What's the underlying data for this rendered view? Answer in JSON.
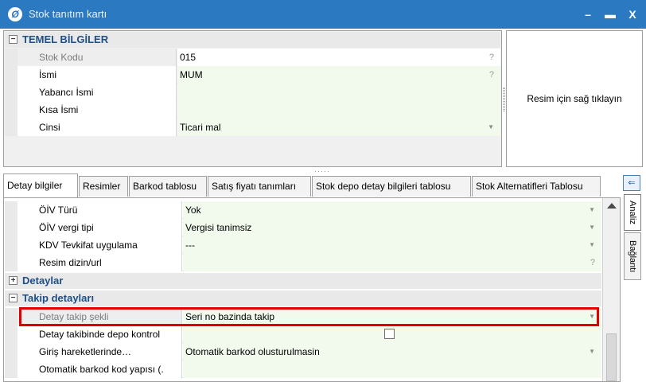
{
  "window": {
    "title": "Stok tanıtım kartı",
    "app_icon": "logo-icon",
    "minimize": "–",
    "maximize": "▬",
    "close": "X"
  },
  "top": {
    "category": "TEMEL BİLGİLER",
    "collapse_symbol": "−",
    "rows": [
      {
        "name": "Stok Kodu",
        "value": "015",
        "hint": "?"
      },
      {
        "name": "İsmi",
        "value": "MUM",
        "hint": "?"
      },
      {
        "name": "Yabancı İsmi",
        "value": ""
      },
      {
        "name": "Kısa İsmi",
        "value": ""
      },
      {
        "name": "Cinsi",
        "value": "Ticari mal",
        "arrow": "▼"
      }
    ]
  },
  "image_panel": {
    "text": "Resim için sağ tıklayın"
  },
  "splitter": "·····",
  "tabs": [
    "Detay bilgiler",
    "Resimler",
    "Barkod tablosu",
    "Satış fiyatı tanımları",
    "Stok depo detay bilgileri tablosu",
    "Stok Alternatifleri Tablosu"
  ],
  "bottom": {
    "rows_a": [
      {
        "name": "ÖİV Türü",
        "value": "Yok",
        "arrow": "▼"
      },
      {
        "name": "ÖİV vergi tipi",
        "value": "Vergisi tanimsiz",
        "arrow": "▼"
      },
      {
        "name": "KDV Tevkifat uygulama",
        "value": "---",
        "arrow": "▼"
      },
      {
        "name": "Resim dizin/url",
        "value": "",
        "hint": "?"
      }
    ],
    "cat_detaylar": "Detaylar",
    "cat_detaylar_symbol": "+",
    "cat_takip": "Takip detayları",
    "cat_takip_symbol": "−",
    "rows_b": [
      {
        "name": "Detay takip şekli",
        "value": "Seri no bazinda takip",
        "arrow": "▼"
      },
      {
        "name": "Detay takibinde depo kontrol",
        "value": "",
        "checked": false
      },
      {
        "name": "Giriş hareketlerinde…",
        "value": "Otomatik barkod olusturulmasin",
        "arrow": "▼"
      },
      {
        "name": "Otomatik barkod kod yapısı (.",
        "value": ""
      }
    ]
  },
  "side": {
    "pin": "⇐",
    "tabs": [
      "Analiz",
      "Bağlantı"
    ]
  }
}
